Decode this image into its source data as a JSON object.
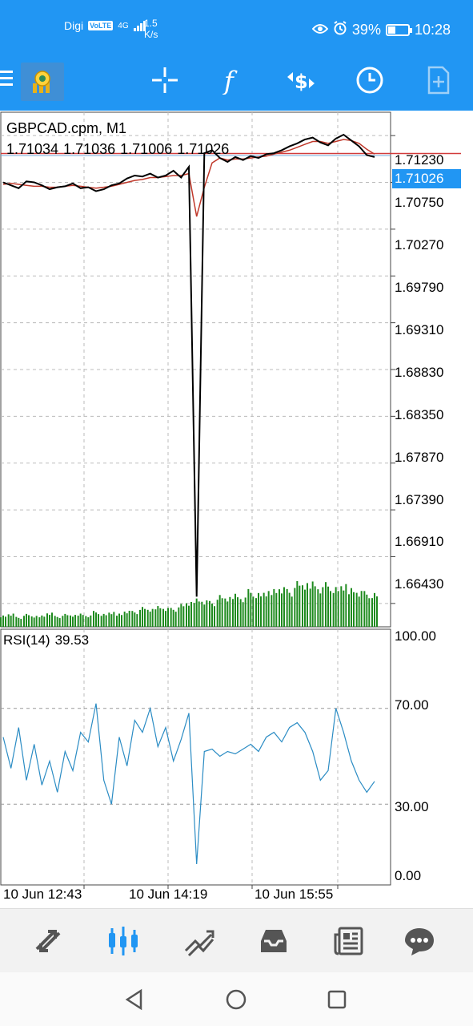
{
  "status_bar": {
    "carrier": "Digi",
    "volte": "VoLTE",
    "network": "4G",
    "speed_value": "1.5",
    "speed_unit": "K/s",
    "battery": "39%",
    "battery_level": 0.39,
    "time": "10:28"
  },
  "toolbar": {
    "icons": [
      "menu-icon",
      "app-logo-icon",
      "crosshair-icon",
      "indicators-icon",
      "trade-icon",
      "timeframe-icon",
      "add-object-icon"
    ]
  },
  "chart": {
    "symbol": "GBPCAD.cpm, M1",
    "ohlc": [
      "1.71034",
      "1.71036",
      "1.71006",
      "1.71026"
    ],
    "current_price": "1.71026",
    "price_levels": [
      "1.71230",
      "1.70750",
      "1.70270",
      "1.69790",
      "1.69310",
      "1.68830",
      "1.68350",
      "1.67870",
      "1.67390",
      "1.66910",
      "1.66430"
    ],
    "rsi_label": "RSI(14)",
    "rsi_value": "39.53",
    "rsi_levels": [
      "100.00",
      "70.00",
      "30.00",
      "0.00"
    ],
    "time_labels": [
      "10 Jun 12:43",
      "10 Jun 14:19",
      "10 Jun 15:55"
    ],
    "colors": {
      "accent": "#2196f3",
      "price_line": "#000000",
      "moving_average": "#c0392b",
      "volume": "#1e8a1e",
      "rsi_line": "#2b8cc4",
      "current_price_line": "#6fa8dc",
      "ask_line": "#d23b3b"
    }
  },
  "chart_data": {
    "type": "line",
    "title": "GBPCAD.cpm, M1",
    "x": [
      "10 Jun 12:43",
      "10 Jun 14:19",
      "10 Jun 15:55"
    ],
    "ylim": [
      1.6619,
      1.7147
    ],
    "series": [
      {
        "values": [
          1.7075,
          1.7072,
          1.7069,
          1.7076,
          1.7075,
          1.7072,
          1.7068,
          1.707,
          1.7071,
          1.7074,
          1.7069,
          1.707,
          1.7066,
          1.7068,
          1.7072,
          1.7074,
          1.7079,
          1.7082,
          1.7081,
          1.7084,
          1.708,
          1.7082,
          1.7087,
          1.708,
          1.7091,
          1.665,
          1.7105,
          1.7108,
          1.71,
          1.7096,
          1.7101,
          1.7098,
          1.7102,
          1.71,
          1.7104,
          1.7105,
          1.7108,
          1.7112,
          1.7115,
          1.7119,
          1.7121,
          1.7116,
          1.7113,
          1.712,
          1.7124,
          1.7118,
          1.7112,
          1.7103,
          1.7101
        ]
      },
      {
        "values": [
          1.7073,
          1.7074,
          1.7073,
          1.7072,
          1.7071,
          1.7071,
          1.707,
          1.707,
          1.7071,
          1.7072,
          1.7071,
          1.707,
          1.7069,
          1.707,
          1.7071,
          1.7073,
          1.7075,
          1.7077,
          1.7078,
          1.708,
          1.708,
          1.7081,
          1.7082,
          1.7082,
          1.7084,
          1.704,
          1.707,
          1.7095,
          1.71,
          1.7098,
          1.7099,
          1.7099,
          1.71,
          1.7101,
          1.7102,
          1.7104,
          1.7106,
          1.7108,
          1.7111,
          1.7114,
          1.7117,
          1.7117,
          1.7115,
          1.7117,
          1.7119,
          1.7118,
          1.7115,
          1.7109,
          1.7104
        ]
      }
    ],
    "volume": [
      12,
      14,
      10,
      13,
      11,
      12,
      15,
      11,
      13,
      12,
      14,
      12,
      16,
      13,
      15,
      14,
      17,
      16,
      20,
      18,
      22,
      20,
      19,
      23,
      25,
      30,
      28,
      26,
      32,
      30,
      35,
      31,
      38,
      34,
      36,
      40,
      42,
      38,
      46,
      44,
      48,
      42,
      45,
      40,
      43,
      41,
      38,
      36,
      34
    ],
    "rsi": {
      "label": "RSI(14)",
      "ylim": [
        0,
        100
      ],
      "levels": [
        70,
        30
      ],
      "values": [
        58,
        45,
        62,
        40,
        55,
        38,
        48,
        35,
        52,
        44,
        60,
        56,
        72,
        40,
        30,
        58,
        46,
        65,
        60,
        70,
        54,
        62,
        48,
        57,
        68,
        5,
        52,
        53,
        50,
        52,
        51,
        53,
        55,
        52,
        58,
        60,
        56,
        62,
        64,
        60,
        52,
        40,
        44,
        70,
        60,
        48,
        40,
        35,
        39.53
      ]
    }
  }
}
